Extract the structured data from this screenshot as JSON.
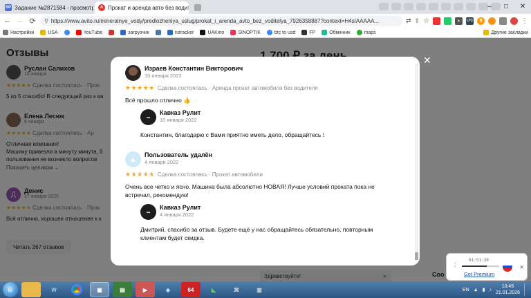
{
  "browser": {
    "tabs": [
      {
        "favicon": "SP",
        "favicon_color": "#4a6fd6",
        "title": "Задание №2871584 - просмотр з"
      },
      {
        "favicon": "A",
        "favicon_color": "#e4312b",
        "title": "Прокат и аренда авто без водите"
      }
    ],
    "url": "https://www.avito.ru/mineralnye_vody/predlozheniya_uslug/prokat_i_arenda_avto_bez_voditelya_7926358887?context=H4sIAAAAA...",
    "bookmarks": [
      "Настройки",
      "USA",
      "YouTube",
      "загрузчик",
      "rutracker",
      "UAKino",
      "SINOPTIK",
      "btc to usd",
      "FP",
      "Обмінник",
      "maps"
    ],
    "other_bookmarks": "Другие закладки"
  },
  "page": {
    "heading": "Отзывы",
    "price_partial": "1 700 ₽ за день",
    "read_all": "Читать 267 отзывов",
    "chat_placeholder": "Здравствуйте!",
    "side_heading_partial": "Соо",
    "bg_reviews": [
      {
        "name": "Руслан Салихов",
        "date": "16 января",
        "stars": "★★★★★",
        "deal": "Сделка состоялась · Прок",
        "text": "5 из 5 спасибо! В следующий раз к ва"
      },
      {
        "name": "Елена Лесюк",
        "date": "8 января",
        "stars": "★★★★★",
        "deal": "Сделка состоялась · Ар",
        "text": "Отличная компания!\nМашину привезли в минуту минута, б\nпользования не возникло вопросов",
        "show_all": "Показать целиком ⌄"
      },
      {
        "name": "Денис",
        "date": "27 января 2025",
        "stars": "★★★★★",
        "deal": "Сделка состоялась · Прок",
        "text": "Всё отлично, хорошее отношение к к",
        "avatar_letter": "Д"
      }
    ]
  },
  "modal": {
    "reviews": [
      {
        "name": "Израев Константин Викторович",
        "date": "10 января 2022",
        "stars": "★★★★★",
        "deal": "Сделка состоялась · Аренда прокат автомобиля без водителя",
        "text": "Всё прошло отлично 👍",
        "reply": {
          "name": "Кавказ Рулит",
          "date": "10 января 2022",
          "text": "Константин, благодарю с Вами приятно иметь дело, обращайтесь !"
        }
      },
      {
        "name": "Пользователь удалён",
        "date": "4 января 2022",
        "stars": "★★★★★",
        "deal": "Сделка состоялась · Прокат автомобили",
        "text": "Очень все четко и ясно. Машина была абсолютно НОВАЯ! Лучше условий проката пока не встречал, рекомендую!",
        "reply": {
          "name": "Кавказ Рулит",
          "date": "4 января 2022",
          "text": "Дмитрий, спасибо за отзыв. Будете ещё у нас обращайтесь обязательно, повторным клиентам будет скидка."
        }
      }
    ]
  },
  "popup": {
    "time": "01:51:30",
    "link": "Get Premium"
  },
  "taskbar": {
    "lang": "EN",
    "time": "10:45",
    "date": "21.01.2026",
    "app_64_label": "64"
  }
}
